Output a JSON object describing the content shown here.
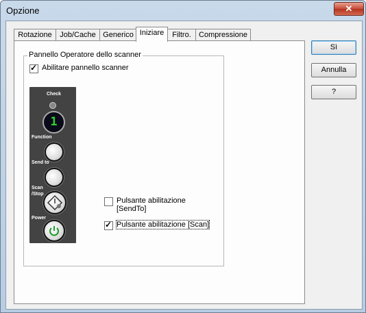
{
  "window": {
    "title": "Opzione",
    "close_glyph": "✕"
  },
  "tabs": [
    {
      "label": "Rotazione"
    },
    {
      "label": "Job/Cache"
    },
    {
      "label": "Generico"
    },
    {
      "label": "Iniziare"
    },
    {
      "label": "Filtro."
    },
    {
      "label": "Compressione"
    }
  ],
  "active_tab": "Iniziare",
  "group": {
    "title": "Pannello Operatore dello scanner",
    "enable_panel": {
      "label": "Abilitare pannello scanner",
      "checked": true
    }
  },
  "panel": {
    "check_label": "Check",
    "display_value": "1",
    "function_label": "Function",
    "sendto_label": "Send to",
    "scanstop_label_1": "Scan",
    "scanstop_label_2": "/Stop",
    "power_label": "Power"
  },
  "options": {
    "sendto": {
      "label_1": "Pulsante abilitazione",
      "label_2": "[SendTo]",
      "checked": false
    },
    "scan": {
      "label": "Pulsante abilitazione [Scan]",
      "checked": true
    }
  },
  "buttons": {
    "ok": "Sì",
    "cancel": "Annulla",
    "help": "?"
  },
  "colors": {
    "display_digit": "#2fd12f",
    "title_bg": "#c8d9ea",
    "close_red": "#c74a36"
  }
}
